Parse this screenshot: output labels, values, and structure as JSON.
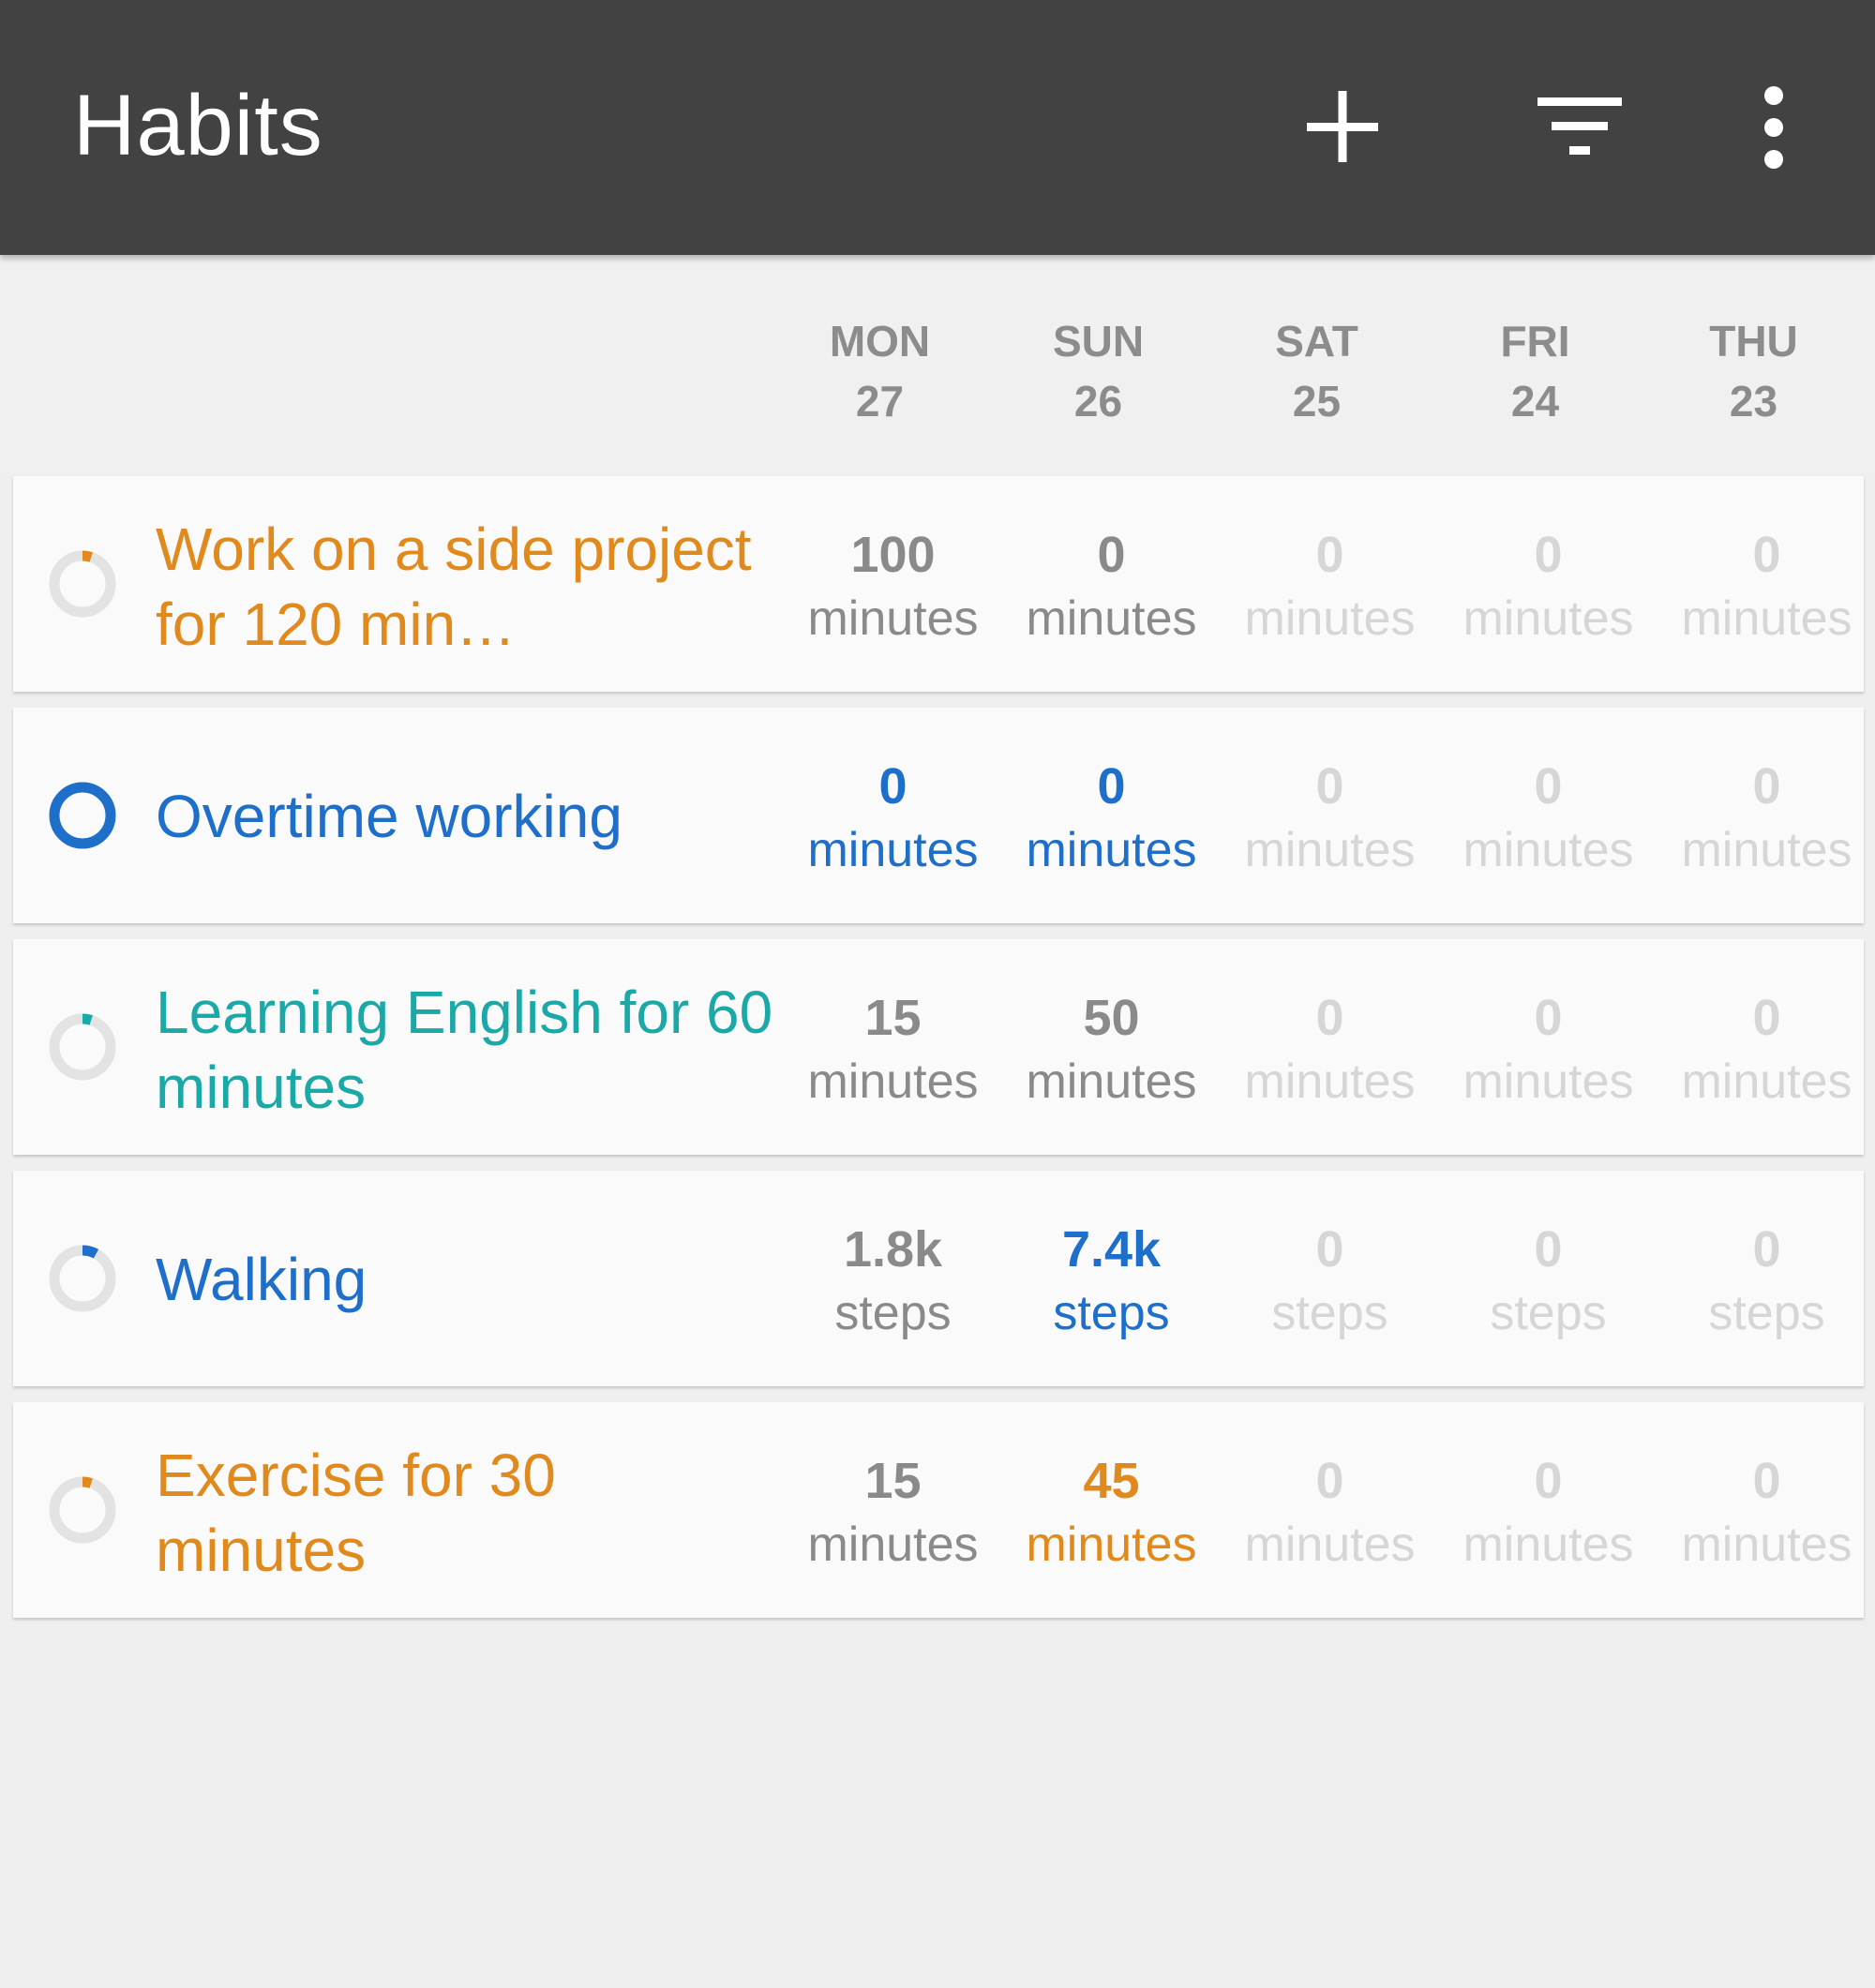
{
  "toolbar": {
    "title": "Habits",
    "add_icon": "plus-icon",
    "filter_icon": "filter-icon",
    "more_icon": "more-vertical-icon"
  },
  "days": [
    {
      "name": "MON",
      "num": "27"
    },
    {
      "name": "SUN",
      "num": "26"
    },
    {
      "name": "SAT",
      "num": "25"
    },
    {
      "name": "FRI",
      "num": "24"
    },
    {
      "name": "THU",
      "num": "23"
    }
  ],
  "colors": {
    "orange": "#e08a1e",
    "blue": "#1e6fc9",
    "teal": "#1aa9a6",
    "gray_value": "#8a8a8a",
    "faded_value": "#d6d6d6"
  },
  "habits": [
    {
      "name": "Work on a side project for 120 min…",
      "color": "#e08a1e",
      "progress": 0.05,
      "cells": [
        {
          "value": "100",
          "unit": "minutes",
          "state": "normal"
        },
        {
          "value": "0",
          "unit": "minutes",
          "state": "normal"
        },
        {
          "value": "0",
          "unit": "minutes",
          "state": "faded"
        },
        {
          "value": "0",
          "unit": "minutes",
          "state": "faded"
        },
        {
          "value": "0",
          "unit": "minutes",
          "state": "faded"
        }
      ]
    },
    {
      "name": "Overtime working",
      "color": "#1e6fc9",
      "progress": 1.0,
      "cells": [
        {
          "value": "0",
          "unit": "minutes",
          "state": "accent"
        },
        {
          "value": "0",
          "unit": "minutes",
          "state": "accent"
        },
        {
          "value": "0",
          "unit": "minutes",
          "state": "faded"
        },
        {
          "value": "0",
          "unit": "minutes",
          "state": "faded"
        },
        {
          "value": "0",
          "unit": "minutes",
          "state": "faded"
        }
      ]
    },
    {
      "name": "Learning English for 60 minutes",
      "color": "#1aa9a6",
      "progress": 0.05,
      "cells": [
        {
          "value": "15",
          "unit": "minutes",
          "state": "normal"
        },
        {
          "value": "50",
          "unit": "minutes",
          "state": "normal"
        },
        {
          "value": "0",
          "unit": "minutes",
          "state": "faded"
        },
        {
          "value": "0",
          "unit": "minutes",
          "state": "faded"
        },
        {
          "value": "0",
          "unit": "minutes",
          "state": "faded"
        }
      ]
    },
    {
      "name": "Walking",
      "color": "#1e6fc9",
      "progress": 0.08,
      "cells": [
        {
          "value": "1.8k",
          "unit": "steps",
          "state": "normal"
        },
        {
          "value": "7.4k",
          "unit": "steps",
          "state": "accent"
        },
        {
          "value": "0",
          "unit": "steps",
          "state": "faded"
        },
        {
          "value": "0",
          "unit": "steps",
          "state": "faded"
        },
        {
          "value": "0",
          "unit": "steps",
          "state": "faded"
        }
      ]
    },
    {
      "name": "Exercise for 30 minutes",
      "color": "#e08a1e",
      "progress": 0.05,
      "cells": [
        {
          "value": "15",
          "unit": "minutes",
          "state": "normal"
        },
        {
          "value": "45",
          "unit": "minutes",
          "state": "accent"
        },
        {
          "value": "0",
          "unit": "minutes",
          "state": "faded"
        },
        {
          "value": "0",
          "unit": "minutes",
          "state": "faded"
        },
        {
          "value": "0",
          "unit": "minutes",
          "state": "faded"
        }
      ]
    }
  ]
}
